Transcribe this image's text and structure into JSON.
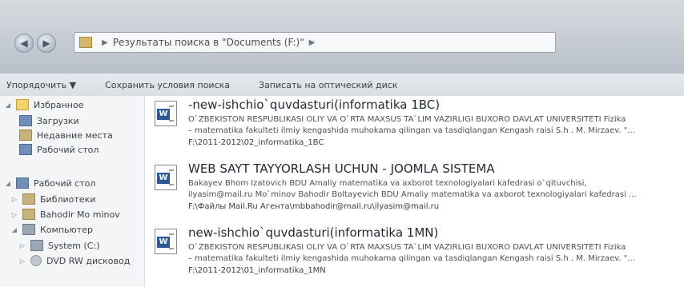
{
  "address": {
    "breadcrumb": "Результаты поиска в \"Documents (F:)\"",
    "nav_back_glyph": "◀",
    "nav_forward_glyph": "▶"
  },
  "toolbar": {
    "items": [
      "Упорядочить ▼",
      "Сохранить условия поиска",
      "Записать на оптический диск"
    ]
  },
  "navpane": {
    "items": [
      {
        "label": "Избранное",
        "icon": "star-icon"
      },
      {
        "label": "Загрузки",
        "icon": "download-icon"
      },
      {
        "label": "Недавние места",
        "icon": "recent-places-icon"
      },
      {
        "label": "Рабочий стол",
        "icon": "desktop-icon"
      },
      {
        "label": "Рабочий стол",
        "icon": "desktop-icon"
      },
      {
        "label": "Библиотеки",
        "icon": "libraries-icon"
      },
      {
        "label": "Bahodir Mo minov",
        "icon": "user-folder-icon"
      },
      {
        "label": "Компьютер",
        "icon": "computer-icon"
      },
      {
        "label": "System (C:)",
        "icon": "drive-icon"
      },
      {
        "label": "DVD RW дисковод",
        "icon": "dvd-drive-icon"
      }
    ]
  },
  "results": [
    {
      "title": "-new-ishchio`quvdasturi(informatika 1BC)",
      "desc1": "O`ZBEKISTON RESPUBLIKASI OLIY VA O`RTA MAXSUS TA`LIM VAZIRLIGI BUXORO DAVLAT UNIVERSITETI Fizika",
      "desc2": "– matematika fakulteti ilmiy kengashida muhokama qilingan va tasdiqlangan Kengash raisi S.h . M. Mirzaev. \"...",
      "path": "F:\\2011-2012\\02_informatika_1BC"
    },
    {
      "title": "WEB SAYT TAYYORLASH UCHUN - JOOMLA SISTEMA",
      "desc1": "Bakayev Bhom Izatovich BDU Amaliy matematika va axborot texnologiyalari kafedrasi o`qituvchisi,",
      "desc2": "ilyasim@mail.ru Mo`minov Bahodir Boltayevich BDU Amaliy matematika va axborot texnologiyalari kafedrasi ...",
      "path": "F:\\Файлы Mail.Ru Агента\\mbbahodir@mail.ru\\ilyasim@mail.ru"
    },
    {
      "title": "new-ishchio`quvdasturi(informatika 1MN)",
      "desc1": "O`ZBEKISTON RESPUBLIKASI OLIY VA O`RTA MAXSUS TA`LIM VAZIRLIGI BUXORO DAVLAT UNIVERSITETI Fizika",
      "desc2": "– matematika fakulteti ilmiy kengashida muhokama qilingan va tasdiqlangan Kengash raisi S.h . M. Mirzaev. \"...",
      "path": "F:\\2011-2012\\01_informatika_1MN"
    }
  ]
}
